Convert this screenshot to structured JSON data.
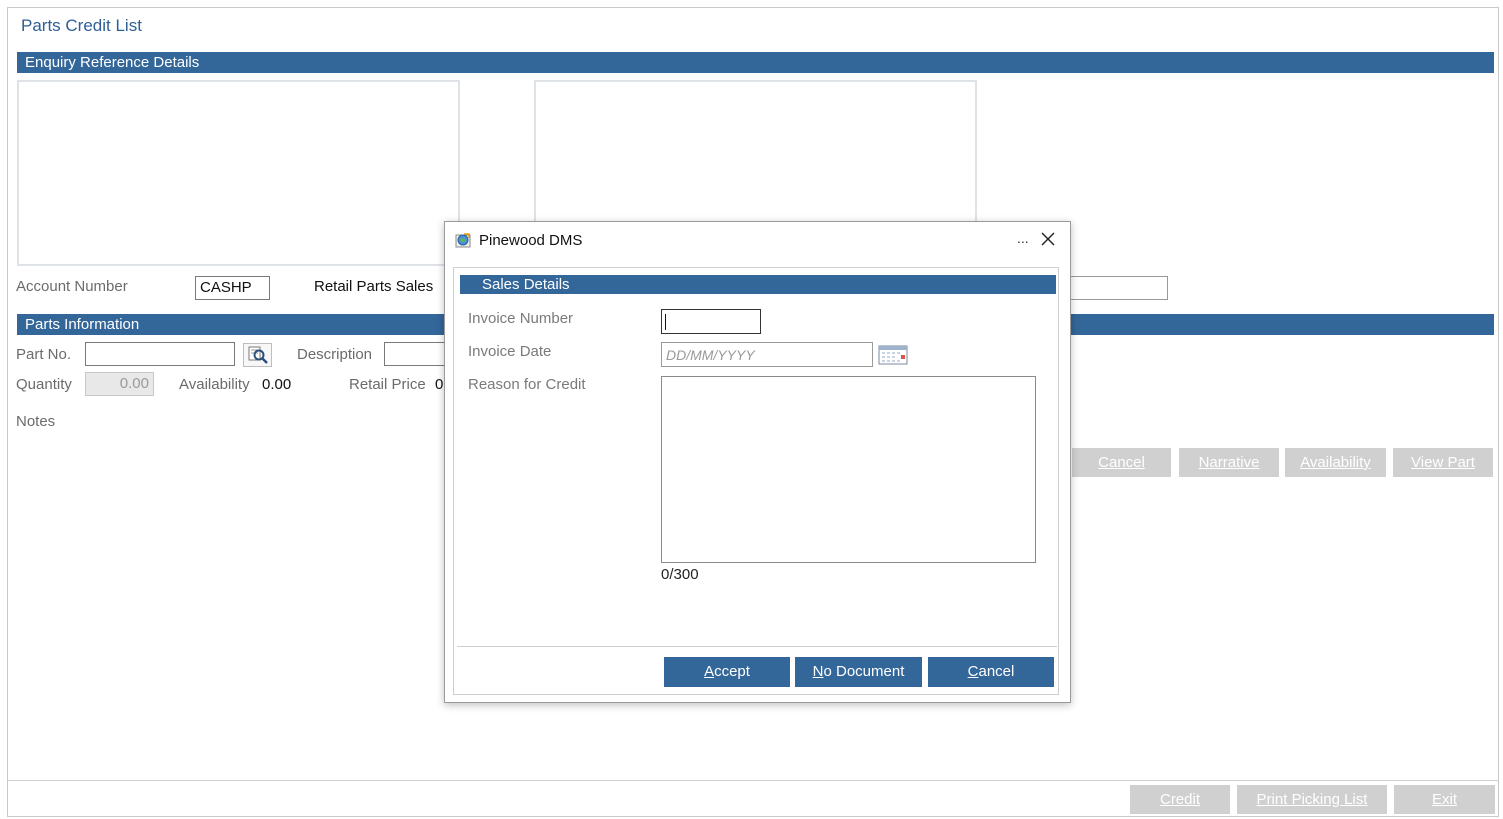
{
  "page": {
    "title": "Parts Credit List"
  },
  "enquiry": {
    "section_title": "Enquiry Reference Details"
  },
  "account": {
    "label": "Account Number",
    "value": "CASHP",
    "type_text": "Retail Parts Sales"
  },
  "parts": {
    "section_title": "Parts Information",
    "part_no_label": "Part No.",
    "part_no_value": "",
    "description_label": "Description",
    "quantity_label": "Quantity",
    "quantity_value": "0.00",
    "availability_label": "Availability",
    "availability_value": "0.00",
    "retail_price_label": "Retail Price",
    "retail_price_value": "0",
    "notes_label": "Notes"
  },
  "action_buttons": {
    "cancel": {
      "first": "C",
      "rest": "ancel"
    },
    "narrative": {
      "first": "N",
      "rest": "arrative"
    },
    "availability": "Availability",
    "view_part": {
      "first": "V",
      "rest": "iew Part"
    }
  },
  "footer_buttons": {
    "credit": "Credit",
    "print_picking_list": {
      "first": "P",
      "rest": "rint Picking List"
    },
    "exit": {
      "first": "E",
      "rest": "xit"
    }
  },
  "dialog": {
    "title": "Pinewood DMS",
    "ellipsis": "...",
    "section_title": "Sales Details",
    "invoice_number_label": "Invoice Number",
    "invoice_number_value": "",
    "invoice_date_label": "Invoice Date",
    "invoice_date_placeholder": "DD/MM/YYYY",
    "reason_label": "Reason for Credit",
    "reason_value": "",
    "char_counter": "0/300",
    "buttons": {
      "accept": {
        "first": "A",
        "rest": "ccept"
      },
      "no_document": {
        "first": "N",
        "rest": "o Document"
      },
      "cancel": {
        "first": "C",
        "rest": "ancel"
      }
    }
  },
  "colors": {
    "accent": "#336699",
    "title_text": "#2f5f95",
    "disabled_button": "#d0d0d0"
  }
}
